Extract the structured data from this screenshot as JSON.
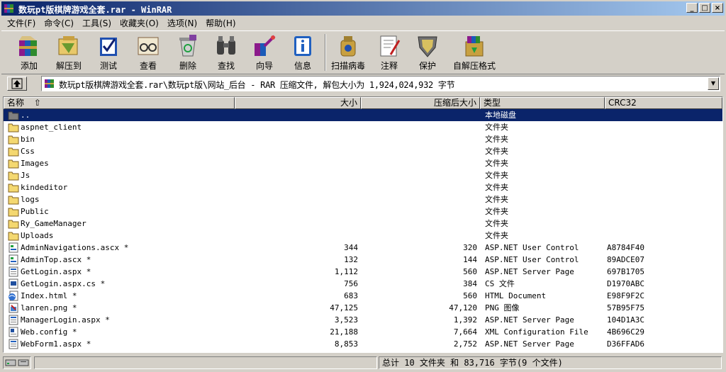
{
  "window": {
    "title": "数玩pt版棋牌游戏全套.rar - WinRAR"
  },
  "menu": [
    "文件(F)",
    "命令(C)",
    "工具(S)",
    "收藏夹(O)",
    "选项(N)",
    "帮助(H)"
  ],
  "toolbar": [
    {
      "label": "添加",
      "icon": "add-books-icon"
    },
    {
      "label": "解压到",
      "icon": "extract-folder-icon"
    },
    {
      "label": "测试",
      "icon": "test-check-icon"
    },
    {
      "label": "查看",
      "icon": "view-glasses-icon"
    },
    {
      "label": "删除",
      "icon": "delete-recycle-icon"
    },
    {
      "label": "查找",
      "icon": "find-binoculars-icon"
    },
    {
      "label": "向导",
      "icon": "wizard-icon"
    },
    {
      "label": "信息",
      "icon": "info-icon"
    },
    {
      "label": "扫描病毒",
      "icon": "virus-scan-icon"
    },
    {
      "label": "注释",
      "icon": "comment-icon"
    },
    {
      "label": "保护",
      "icon": "protect-shield-icon"
    },
    {
      "label": "自解压格式",
      "icon": "sfx-box-icon"
    }
  ],
  "address": {
    "text": "数玩pt版棋牌游戏全套.rar\\数玩pt版\\网站_后台 - RAR 压缩文件, 解包大小为 1,924,024,932 字节"
  },
  "columns": {
    "name": "名称",
    "size": "大小",
    "packed": "压缩后大小",
    "type": "类型",
    "crc": "CRC32"
  },
  "files": [
    {
      "name": "..",
      "size": "",
      "packed": "",
      "type": "本地磁盘",
      "crc": "",
      "kind": "parent",
      "selected": true
    },
    {
      "name": "aspnet_client",
      "size": "",
      "packed": "",
      "type": "文件夹",
      "crc": "",
      "kind": "folder"
    },
    {
      "name": "bin",
      "size": "",
      "packed": "",
      "type": "文件夹",
      "crc": "",
      "kind": "folder"
    },
    {
      "name": "Css",
      "size": "",
      "packed": "",
      "type": "文件夹",
      "crc": "",
      "kind": "folder"
    },
    {
      "name": "Images",
      "size": "",
      "packed": "",
      "type": "文件夹",
      "crc": "",
      "kind": "folder"
    },
    {
      "name": "Js",
      "size": "",
      "packed": "",
      "type": "文件夹",
      "crc": "",
      "kind": "folder"
    },
    {
      "name": "kindeditor",
      "size": "",
      "packed": "",
      "type": "文件夹",
      "crc": "",
      "kind": "folder"
    },
    {
      "name": "logs",
      "size": "",
      "packed": "",
      "type": "文件夹",
      "crc": "",
      "kind": "folder"
    },
    {
      "name": "Public",
      "size": "",
      "packed": "",
      "type": "文件夹",
      "crc": "",
      "kind": "folder"
    },
    {
      "name": "Ry_GameManager",
      "size": "",
      "packed": "",
      "type": "文件夹",
      "crc": "",
      "kind": "folder"
    },
    {
      "name": "Uploads",
      "size": "",
      "packed": "",
      "type": "文件夹",
      "crc": "",
      "kind": "folder"
    },
    {
      "name": "AdminNavigations.ascx *",
      "size": "344",
      "packed": "320",
      "type": "ASP.NET User Control",
      "crc": "A8784F40",
      "kind": "ascx"
    },
    {
      "name": "AdminTop.ascx *",
      "size": "132",
      "packed": "144",
      "type": "ASP.NET User Control",
      "crc": "89ADCE07",
      "kind": "ascx"
    },
    {
      "name": "GetLogin.aspx *",
      "size": "1,112",
      "packed": "560",
      "type": "ASP.NET Server Page",
      "crc": "697B1705",
      "kind": "aspx"
    },
    {
      "name": "GetLogin.aspx.cs *",
      "size": "756",
      "packed": "384",
      "type": "CS 文件",
      "crc": "D1970ABC",
      "kind": "cs"
    },
    {
      "name": "Index.html *",
      "size": "683",
      "packed": "560",
      "type": "HTML Document",
      "crc": "E98F9F2C",
      "kind": "html"
    },
    {
      "name": "lanren.png *",
      "size": "47,125",
      "packed": "47,120",
      "type": "PNG 图像",
      "crc": "57B95F75",
      "kind": "png"
    },
    {
      "name": "ManagerLogin.aspx *",
      "size": "3,523",
      "packed": "1,392",
      "type": "ASP.NET Server Page",
      "crc": "104D1A3C",
      "kind": "aspx"
    },
    {
      "name": "Web.config *",
      "size": "21,188",
      "packed": "7,664",
      "type": "XML Configuration File",
      "crc": "4B696C29",
      "kind": "config"
    },
    {
      "name": "WebForm1.aspx *",
      "size": "8,853",
      "packed": "2,752",
      "type": "ASP.NET Server Page",
      "crc": "D36FFAD6",
      "kind": "aspx"
    }
  ],
  "status": {
    "summary": "总计 10 文件夹 和 83,716 字节(9 个文件)"
  }
}
